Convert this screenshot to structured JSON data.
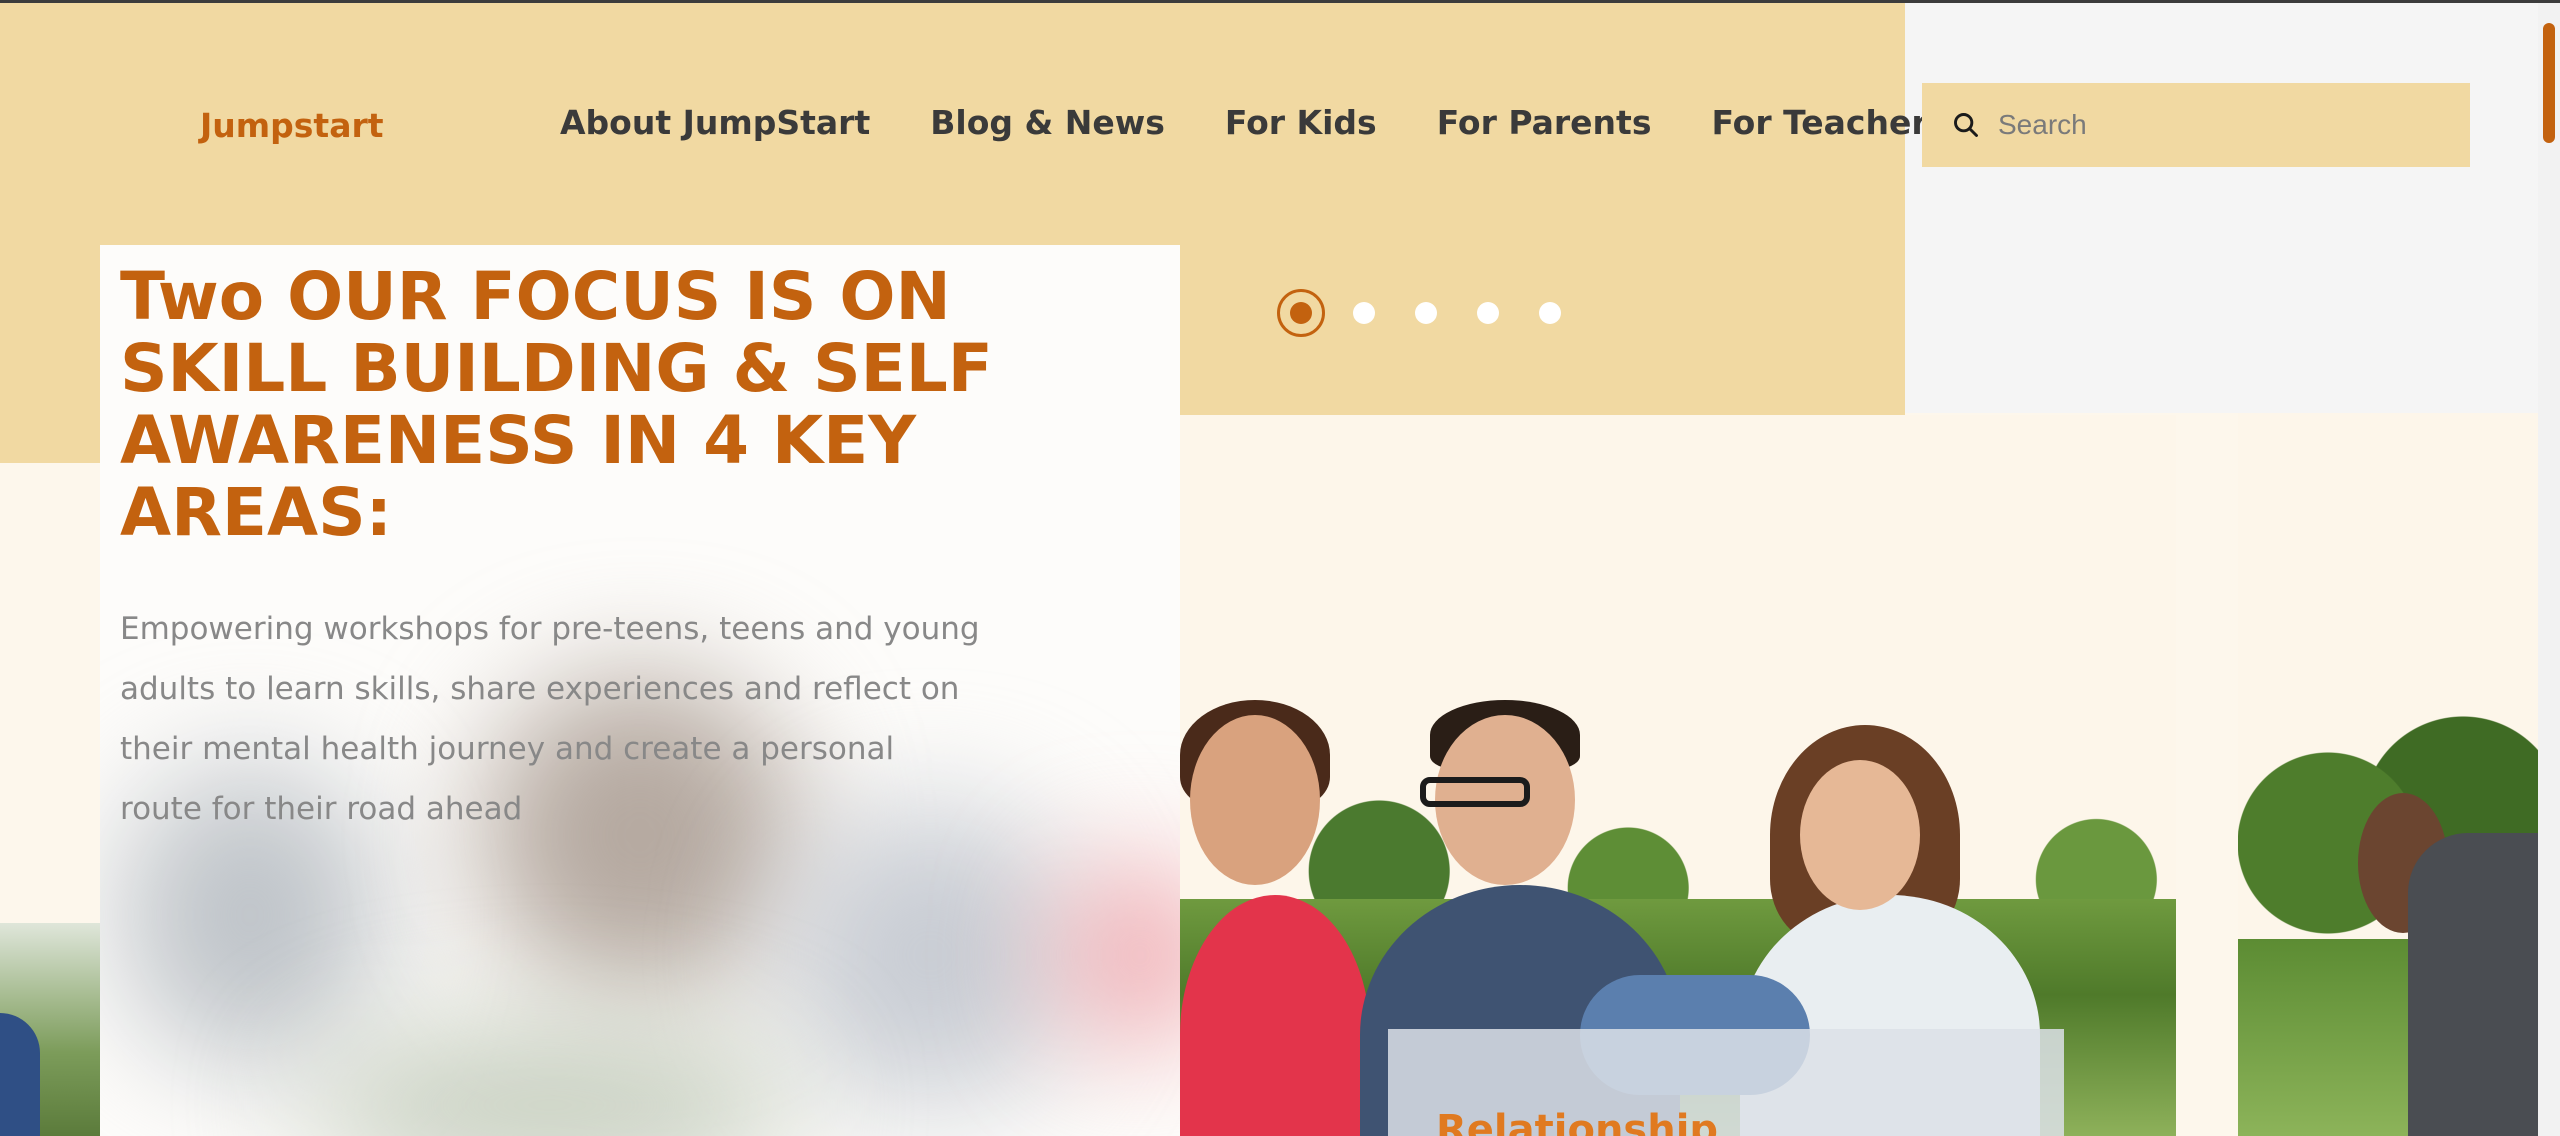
{
  "brand": {
    "name": "Jumpstart"
  },
  "nav": {
    "items": [
      {
        "label": "About JumpStart"
      },
      {
        "label": "Blog & News"
      },
      {
        "label": "For Kids"
      },
      {
        "label": "For Parents"
      },
      {
        "label": "For Teachers"
      }
    ]
  },
  "search": {
    "placeholder": "Search",
    "value": "",
    "icon": "search-icon"
  },
  "carousel": {
    "total_slides": 5,
    "active_slide": 1
  },
  "hero": {
    "title": "Two OUR FOCUS IS ON SKILL BUILDING & SELF AWARENESS IN 4 KEY AREAS:",
    "description": "Empowering workshops for pre-teens, teens and young adults to learn skills, share experiences and reflect on their mental health journey and create a personal route for their road ahead"
  },
  "feature_card": {
    "title": "Relationship"
  },
  "colors": {
    "accent": "#c3620f",
    "header_band": "#f1d9a2",
    "nav_text": "#3a3a3a",
    "body_text": "#888888",
    "page_bg": "#fdf7ec"
  }
}
